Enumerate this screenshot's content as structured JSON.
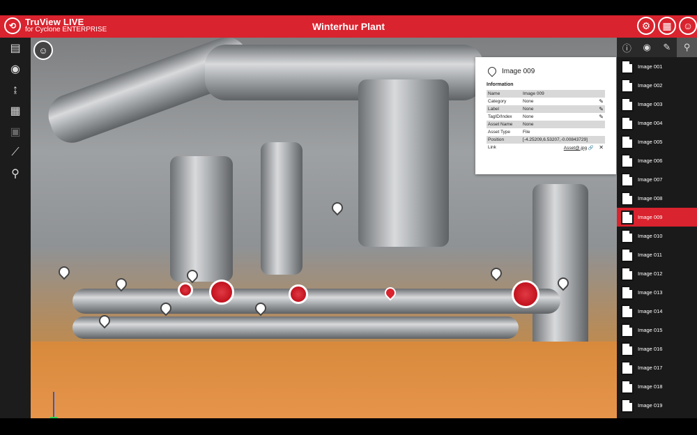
{
  "app": {
    "title": "TruView LIVE",
    "subtitle": "for Cyclone ENTERPRISE",
    "plant_title": "Winterhur Plant"
  },
  "top_icons": [
    "settings-icon",
    "grid-icon",
    "user-icon"
  ],
  "left_toolbar": [
    "map-icon",
    "eye-icon",
    "measure-height-icon",
    "layers-icon",
    "cube-icon",
    "ruler-icon",
    "clipping-icon"
  ],
  "info_panel": {
    "title": "Image 009",
    "section": "Information",
    "rows": [
      {
        "key": "Name",
        "value": "Image 009",
        "editable": false
      },
      {
        "key": "Category",
        "value": "None",
        "editable": true
      },
      {
        "key": "Label",
        "value": "None",
        "editable": true
      },
      {
        "key": "TagID/Index",
        "value": "None",
        "editable": true
      },
      {
        "key": "Asset Name",
        "value": "None",
        "editable": false
      },
      {
        "key": "Asset Type",
        "value": "File",
        "editable": false
      },
      {
        "key": "Position",
        "value": "[-4.25209,6.53207,-0.00843729]",
        "editable": false
      },
      {
        "key": "Link",
        "value": "Asset@.jpg",
        "editable": false
      }
    ]
  },
  "right_panel": {
    "tabs": [
      "info-icon",
      "eye-icon",
      "pencil-icon",
      "pin-icon"
    ],
    "items": [
      {
        "label": "Image 001",
        "selected": false
      },
      {
        "label": "Image 002",
        "selected": false
      },
      {
        "label": "Image 003",
        "selected": false
      },
      {
        "label": "Image 004",
        "selected": false
      },
      {
        "label": "Image 005",
        "selected": false
      },
      {
        "label": "Image 006",
        "selected": false
      },
      {
        "label": "Image 007",
        "selected": false
      },
      {
        "label": "Image 008",
        "selected": false
      },
      {
        "label": "Image 009",
        "selected": true
      },
      {
        "label": "Image 010",
        "selected": false
      },
      {
        "label": "Image 011",
        "selected": false
      },
      {
        "label": "Image 012",
        "selected": false
      },
      {
        "label": "Image 013",
        "selected": false
      },
      {
        "label": "Image 014",
        "selected": false
      },
      {
        "label": "Image 015",
        "selected": false
      },
      {
        "label": "Image 016",
        "selected": false
      },
      {
        "label": "Image 017",
        "selected": false
      },
      {
        "label": "Image 018",
        "selected": false
      },
      {
        "label": "Image 019",
        "selected": false
      }
    ]
  },
  "colors": {
    "accent": "#d9232e",
    "panel_dark": "#1a1a1a"
  }
}
